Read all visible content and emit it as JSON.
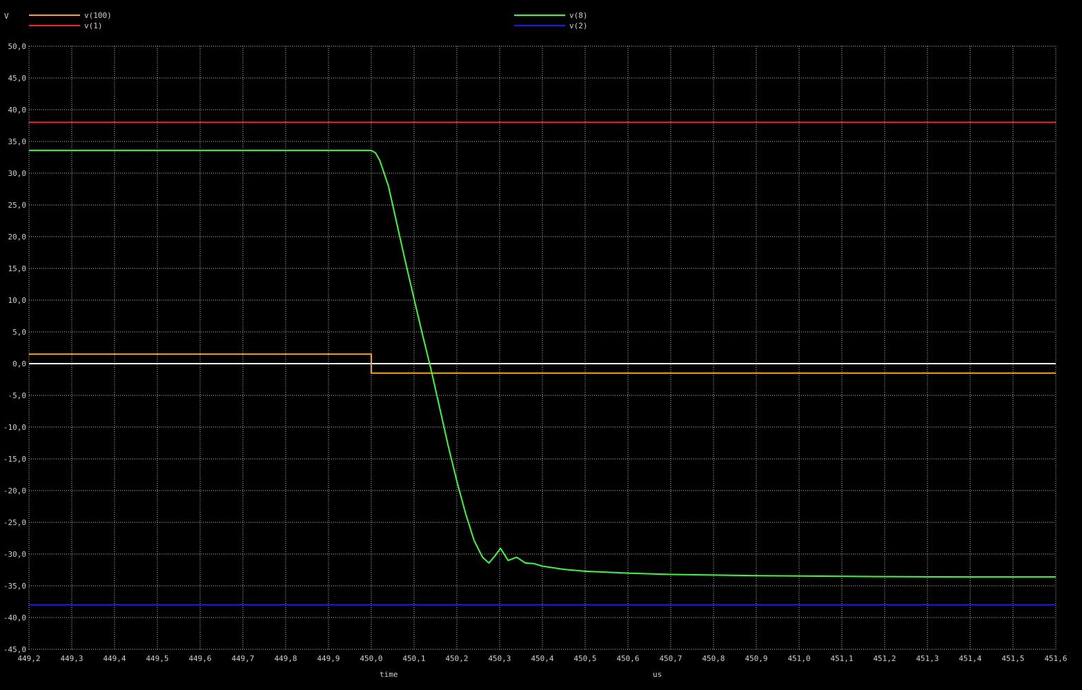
{
  "chart_data": {
    "type": "line",
    "ylabel": "V",
    "x_axis_name": "time",
    "x_unit": "us",
    "xlim": [
      449.2,
      451.6
    ],
    "ylim": [
      -45,
      50
    ],
    "grid": true,
    "legend_placement": "top",
    "x_ticks": [
      "449,2",
      "449,3",
      "449,4",
      "449,5",
      "449,6",
      "449,7",
      "449,8",
      "449,9",
      "450,0",
      "450,1",
      "450,2",
      "450,3",
      "450,4",
      "450,5",
      "450,6",
      "450,7",
      "450,8",
      "450,9",
      "451,0",
      "451,1",
      "451,2",
      "451,3",
      "451,4",
      "451,5",
      "451,6"
    ],
    "y_ticks": [
      "50,0",
      "45,0",
      "40,0",
      "35,0",
      "30,0",
      "25,0",
      "20,0",
      "15,0",
      "10,0",
      "5,0",
      "0,0",
      "-5,0",
      "-10,0",
      "-15,0",
      "-20,0",
      "-25,0",
      "-30,0",
      "-35,0",
      "-40,0",
      "-45,0"
    ],
    "zero_line_color": "#ffffff",
    "series": [
      {
        "name": "v(100)",
        "color": "#ffa500",
        "points": [
          [
            449.2,
            1.5
          ],
          [
            450.0,
            1.5
          ],
          [
            450.0,
            -1.5
          ],
          [
            451.6,
            -1.5
          ]
        ]
      },
      {
        "name": "v(1)",
        "color": "#ff2020",
        "points": [
          [
            449.2,
            38
          ],
          [
            451.6,
            38
          ]
        ]
      },
      {
        "name": "v(8)",
        "color": "#33ff33",
        "points": [
          [
            449.2,
            33.6
          ],
          [
            450.0,
            33.6
          ],
          [
            450.01,
            33.2
          ],
          [
            450.02,
            32
          ],
          [
            450.04,
            28
          ],
          [
            450.06,
            22
          ],
          [
            450.08,
            16
          ],
          [
            450.1,
            10.2
          ],
          [
            450.12,
            4.5
          ],
          [
            450.14,
            -1
          ],
          [
            450.16,
            -7
          ],
          [
            450.18,
            -13
          ],
          [
            450.2,
            -18.5
          ],
          [
            450.22,
            -23.5
          ],
          [
            450.24,
            -27.8
          ],
          [
            450.26,
            -30.5
          ],
          [
            450.275,
            -31.4
          ],
          [
            450.29,
            -30.2
          ],
          [
            450.302,
            -29.1
          ],
          [
            450.32,
            -31.0
          ],
          [
            450.34,
            -30.5
          ],
          [
            450.36,
            -31.4
          ],
          [
            450.38,
            -31.5
          ],
          [
            450.4,
            -31.9
          ],
          [
            450.45,
            -32.4
          ],
          [
            450.5,
            -32.7
          ],
          [
            450.6,
            -33.0
          ],
          [
            450.7,
            -33.2
          ],
          [
            450.8,
            -33.3
          ],
          [
            450.9,
            -33.4
          ],
          [
            451.0,
            -33.45
          ],
          [
            451.2,
            -33.55
          ],
          [
            451.4,
            -33.6
          ],
          [
            451.6,
            -33.6
          ]
        ]
      },
      {
        "name": "v(2)",
        "color": "#1a1aff",
        "points": [
          [
            449.2,
            -38
          ],
          [
            451.6,
            -38
          ]
        ]
      }
    ]
  }
}
